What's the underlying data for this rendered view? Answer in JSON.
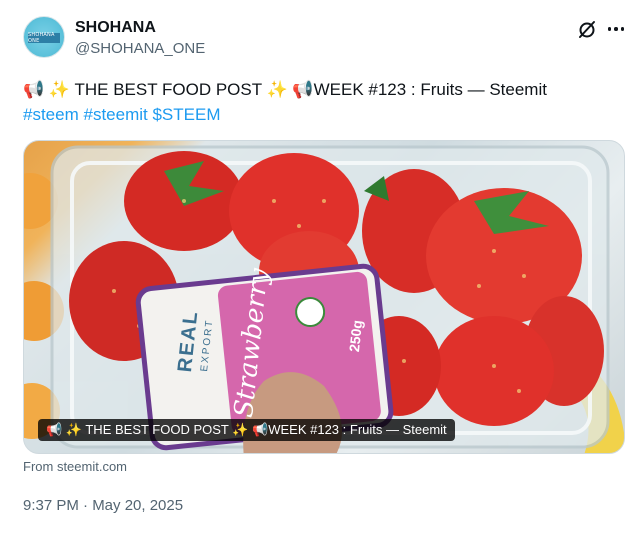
{
  "author": {
    "display_name": "SHOHANA",
    "handle": "@SHOHANA_ONE",
    "avatar_text": "SHOHANA ONE"
  },
  "tweet": {
    "line1": "📢 ✨ THE BEST FOOD POST ✨ 📢WEEK #123 :  Fruits — Steemit",
    "hashtags": [
      "#steem",
      "#steemit",
      "$STEEM"
    ]
  },
  "card": {
    "caption": "📢 ✨ THE BEST FOOD POST ✨ 📢WEEK #123 : Fruits — Steemit",
    "label_brand": "REAL",
    "label_sub": "EXPORT",
    "label_product": "Strawberry",
    "label_weight": "250g"
  },
  "source": "From steemit.com",
  "timestamp": "9:37 PM · May 20, 2025",
  "colors": {
    "text": "#0f1419",
    "muted": "#536471",
    "link": "#1d9bf0",
    "strawberry": "#e0312b"
  },
  "icons": [
    "grok-icon",
    "more-icon"
  ]
}
